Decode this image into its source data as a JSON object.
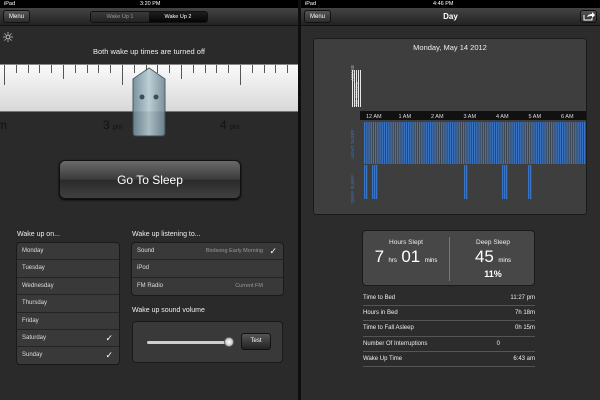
{
  "status_left": {
    "carrier": "iPad",
    "time": "3:20 PM"
  },
  "status_right": {
    "carrier": "iPad",
    "time": "4:46 PM"
  },
  "left": {
    "menu_label": "Menu",
    "segments": [
      "Wake Up 1",
      "Wake Up 2"
    ],
    "selected_segment": "Wake Up 2",
    "message": "Both wake up times are turned off",
    "ruler_labels": [
      {
        "text": "m",
        "unit": ""
      },
      {
        "text": "3",
        "unit": "pm"
      },
      {
        "text": "4",
        "unit": "pm"
      }
    ],
    "go_to_sleep": "Go To Sleep",
    "wake_up_on": {
      "header": "Wake up on...",
      "days": [
        {
          "label": "Monday",
          "checked": false
        },
        {
          "label": "Tuesday",
          "checked": false
        },
        {
          "label": "Wednesday",
          "checked": false
        },
        {
          "label": "Thursday",
          "checked": false
        },
        {
          "label": "Friday",
          "checked": false
        },
        {
          "label": "Saturday",
          "checked": true
        },
        {
          "label": "Sunday",
          "checked": true
        }
      ]
    },
    "listening": {
      "header": "Wake up listening to...",
      "rows": [
        {
          "label": "Sound",
          "value": "Birdsong Early Morning",
          "checked": true
        },
        {
          "label": "iPod",
          "value": "",
          "checked": false
        },
        {
          "label": "FM Radio",
          "value": "Current FM",
          "checked": false
        }
      ]
    },
    "volume": {
      "header": "Wake up sound volume",
      "level": 0.95,
      "test_label": "Test"
    }
  },
  "right": {
    "menu_label": "Menu",
    "title": "Day",
    "chart": {
      "date": "Monday, May 14 2012",
      "axis_hours": [
        "12 AM",
        "1 AM",
        "2 AM",
        "3 AM",
        "4 AM",
        "5 AM",
        "6 AM"
      ],
      "row_labels": [
        "AWAKE",
        "NO SIGNAL",
        "LIGHT SLEEP",
        "DEEP SLEEP"
      ],
      "accent": "#3a74c4"
    },
    "hours_slept": {
      "label": "Hours Slept",
      "hrs": "7",
      "hrs_unit": "hrs",
      "mins": "01",
      "mins_unit": "mins"
    },
    "deep_sleep": {
      "label": "Deep Sleep",
      "mins": "45",
      "mins_unit": "mins",
      "percent": "11%"
    },
    "stats": [
      {
        "label": "Time to Bed",
        "value": "11:27 pm"
      },
      {
        "label": "Hours in Bed",
        "value": "7h 18m"
      },
      {
        "label": "Time to Fall Asleep",
        "value": "0h 15m"
      },
      {
        "label": "Number Of Interruptions",
        "value": "0"
      },
      {
        "label": "Wake Up Time",
        "value": "6:43 am"
      }
    ]
  }
}
